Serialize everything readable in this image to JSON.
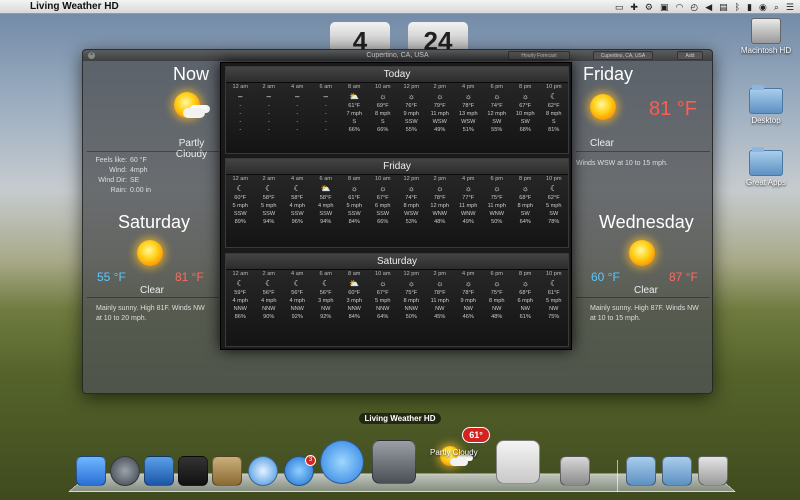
{
  "menubar": {
    "app_name": "Living Weather HD"
  },
  "desktop": {
    "icons": [
      {
        "label": "Macintosh HD"
      },
      {
        "label": "Desktop"
      },
      {
        "label": "Great Apps"
      }
    ]
  },
  "clock": {
    "digit_left": "4",
    "digit_right": "24"
  },
  "window": {
    "location": "Cupertino, CA, USA",
    "buttons": [
      "Hourly Forecast",
      "Cupertino, CA, USA",
      "Add"
    ]
  },
  "now": {
    "title": "Now",
    "condition": "Partly Cloudy",
    "details": [
      {
        "label": "Feels like:",
        "value": "60 °F"
      },
      {
        "label": "Wind:",
        "value": "4mph"
      },
      {
        "label": "Wind Dir:",
        "value": "SE"
      },
      {
        "label": "Rain:",
        "value": "0.00 in"
      }
    ]
  },
  "friday": {
    "title": "Friday",
    "temp": "81 °F",
    "condition": "Clear",
    "desc": "Winds WSW at 10 to 15 mph."
  },
  "saturday": {
    "title": "Saturday",
    "low": "55 °F",
    "high": "81 °F",
    "condition": "Clear",
    "desc_line1": "Mainly sunny. High 81F. Winds NW",
    "desc_line2": "at 10 to 20 mph."
  },
  "wednesday": {
    "title": "Wednesday",
    "low": "60 °F",
    "high": "87 °F",
    "condition": "Clear",
    "desc_line1": "Mainly sunny. High 87F. Winds NW",
    "desc_line2": "at 10 to 15 mph."
  },
  "hourly": [
    {
      "day": "Today",
      "hours": [
        {
          "time": "12 am",
          "icon": "–",
          "temp": "-",
          "wind": "-",
          "dir": "-",
          "hum": "-"
        },
        {
          "time": "2 am",
          "icon": "–",
          "temp": "-",
          "wind": "-",
          "dir": "-",
          "hum": "-"
        },
        {
          "time": "4 am",
          "icon": "–",
          "temp": "-",
          "wind": "-",
          "dir": "-",
          "hum": "-"
        },
        {
          "time": "6 am",
          "icon": "–",
          "temp": "-",
          "wind": "-",
          "dir": "-",
          "hum": "-"
        },
        {
          "time": "8 am",
          "icon": "⛅",
          "temp": "61°F",
          "wind": "7 mph",
          "dir": "S",
          "hum": "66%"
        },
        {
          "time": "10 am",
          "icon": "☼",
          "temp": "69°F",
          "wind": "8 mph",
          "dir": "S",
          "hum": "66%"
        },
        {
          "time": "12 pm",
          "icon": "☼",
          "temp": "76°F",
          "wind": "9 mph",
          "dir": "SSW",
          "hum": "55%"
        },
        {
          "time": "2 pm",
          "icon": "☼",
          "temp": "79°F",
          "wind": "11 mph",
          "dir": "WSW",
          "hum": "49%"
        },
        {
          "time": "4 pm",
          "icon": "☼",
          "temp": "78°F",
          "wind": "13 mph",
          "dir": "WSW",
          "hum": "51%"
        },
        {
          "time": "6 pm",
          "icon": "☼",
          "temp": "74°F",
          "wind": "12 mph",
          "dir": "SW",
          "hum": "55%"
        },
        {
          "time": "8 pm",
          "icon": "☼",
          "temp": "67°F",
          "wind": "10 mph",
          "dir": "SW",
          "hum": "68%"
        },
        {
          "time": "10 pm",
          "icon": "☾",
          "temp": "62°F",
          "wind": "8 mph",
          "dir": "S",
          "hum": "81%"
        }
      ]
    },
    {
      "day": "Friday",
      "hours": [
        {
          "time": "12 am",
          "icon": "☾",
          "temp": "60°F",
          "wind": "5 mph",
          "dir": "SSW",
          "hum": "89%"
        },
        {
          "time": "2 am",
          "icon": "☾",
          "temp": "58°F",
          "wind": "5 mph",
          "dir": "SSW",
          "hum": "94%"
        },
        {
          "time": "4 am",
          "icon": "☾",
          "temp": "58°F",
          "wind": "4 mph",
          "dir": "SSW",
          "hum": "96%"
        },
        {
          "time": "6 am",
          "icon": "⛅",
          "temp": "58°F",
          "wind": "4 mph",
          "dir": "SSW",
          "hum": "94%"
        },
        {
          "time": "8 am",
          "icon": "☼",
          "temp": "61°F",
          "wind": "5 mph",
          "dir": "SSW",
          "hum": "84%"
        },
        {
          "time": "10 am",
          "icon": "☼",
          "temp": "67°F",
          "wind": "6 mph",
          "dir": "SSW",
          "hum": "66%"
        },
        {
          "time": "12 pm",
          "icon": "☼",
          "temp": "74°F",
          "wind": "8 mph",
          "dir": "WSW",
          "hum": "53%"
        },
        {
          "time": "2 pm",
          "icon": "☼",
          "temp": "78°F",
          "wind": "12 mph",
          "dir": "WNW",
          "hum": "48%"
        },
        {
          "time": "4 pm",
          "icon": "☼",
          "temp": "77°F",
          "wind": "11 mph",
          "dir": "WNW",
          "hum": "49%"
        },
        {
          "time": "6 pm",
          "icon": "☼",
          "temp": "75°F",
          "wind": "11 mph",
          "dir": "WNW",
          "hum": "50%"
        },
        {
          "time": "8 pm",
          "icon": "☼",
          "temp": "68°F",
          "wind": "8 mph",
          "dir": "SW",
          "hum": "64%"
        },
        {
          "time": "10 pm",
          "icon": "☾",
          "temp": "62°F",
          "wind": "5 mph",
          "dir": "SW",
          "hum": "78%"
        }
      ]
    },
    {
      "day": "Saturday",
      "hours": [
        {
          "time": "12 am",
          "icon": "☾",
          "temp": "59°F",
          "wind": "4 mph",
          "dir": "NNW",
          "hum": "86%"
        },
        {
          "time": "2 am",
          "icon": "☾",
          "temp": "56°F",
          "wind": "4 mph",
          "dir": "NNW",
          "hum": "90%"
        },
        {
          "time": "4 am",
          "icon": "☾",
          "temp": "56°F",
          "wind": "4 mph",
          "dir": "NNW",
          "hum": "92%"
        },
        {
          "time": "6 am",
          "icon": "☾",
          "temp": "56°F",
          "wind": "3 mph",
          "dir": "NW",
          "hum": "92%"
        },
        {
          "time": "8 am",
          "icon": "⛅",
          "temp": "60°F",
          "wind": "3 mph",
          "dir": "NNW",
          "hum": "84%"
        },
        {
          "time": "10 am",
          "icon": "☼",
          "temp": "67°F",
          "wind": "5 mph",
          "dir": "NNW",
          "hum": "64%"
        },
        {
          "time": "12 pm",
          "icon": "☼",
          "temp": "75°F",
          "wind": "8 mph",
          "dir": "NNW",
          "hum": "50%"
        },
        {
          "time": "2 pm",
          "icon": "☼",
          "temp": "78°F",
          "wind": "11 mph",
          "dir": "NW",
          "hum": "45%"
        },
        {
          "time": "4 pm",
          "icon": "☼",
          "temp": "78°F",
          "wind": "9 mph",
          "dir": "NW",
          "hum": "46%"
        },
        {
          "time": "6 pm",
          "icon": "☼",
          "temp": "75°F",
          "wind": "8 mph",
          "dir": "NW",
          "hum": "48%"
        },
        {
          "time": "8 pm",
          "icon": "☼",
          "temp": "68°F",
          "wind": "6 mph",
          "dir": "NW",
          "hum": "61%"
        },
        {
          "time": "10 pm",
          "icon": "☾",
          "temp": "61°F",
          "wind": "5 mph",
          "dir": "NW",
          "hum": "75%"
        }
      ]
    }
  ],
  "dock": {
    "hover_label": "Living Weather HD",
    "weather_badge": "61°",
    "weather_text": "Partly Cloudy",
    "appstore_badge": "3"
  },
  "colors": {
    "low_temp": "#5cc6ff",
    "high_temp": "#ff6a5e"
  }
}
